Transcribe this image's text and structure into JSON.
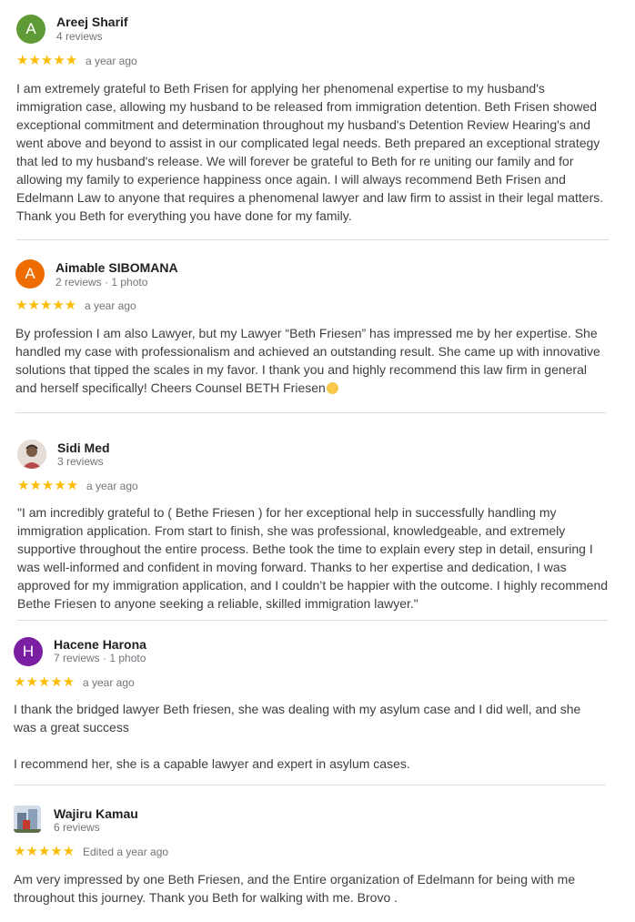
{
  "reviews": [
    {
      "initial": "A",
      "avatar_color": "#5e9b37",
      "name": "Areej Sharif",
      "meta": "4 reviews",
      "stars": "★★★★★",
      "ago": "a year ago",
      "text": "I am extremely grateful to Beth Frisen for applying her phenomenal expertise to my husband's immigration case, allowing my husband to be released from immigration detention. Beth Frisen showed exceptional commitment and determination throughout my husband's Detention Review Hearing's and went above and beyond to assist in our complicated legal needs. Beth prepared an exceptional strategy that led to my husband's release. We will forever be grateful to Beth for re uniting our family and for allowing my family to experience happiness once again. I will always recommend Beth Frisen and Edelmann Law to anyone that requires a phenomenal lawyer and law firm to assist in their legal matters. Thank you Beth for everything you have done for my family."
    },
    {
      "initial": "A",
      "avatar_color": "#ef6c00",
      "name": "Aimable SIBOMANA",
      "meta": "2 reviews · 1 photo",
      "stars": "★★★★★",
      "ago": "a year ago",
      "text": "By profession I am also Lawyer, but my Lawyer “Beth Friesen” has impressed me by her expertise. She handled my case with professionalism and achieved an outstanding result. She came up with innovative solutions that tipped the scales in my favor. I thank you and highly recommend this law firm in general and herself specifically! Cheers Counsel BETH Friesen"
    },
    {
      "initial": "",
      "avatar_color": "#c9b6a6",
      "name": "Sidi Med",
      "meta": "3 reviews",
      "stars": "★★★★★",
      "ago": "a year ago",
      "text": "\"I am incredibly grateful to ( Bethe Friesen ) for her exceptional help in successfully handling my immigration application. From start to finish, she was professional, knowledgeable, and extremely supportive throughout the entire process. Bethe took the time to explain every step in detail, ensuring I was well-informed and confident in moving forward. Thanks to her expertise and dedication, I was approved for my immigration application, and I couldn’t be happier with the outcome. I highly recommend Bethe Friesen to anyone seeking a reliable, skilled immigration lawyer.\""
    },
    {
      "initial": "H",
      "avatar_color": "#7b1fa2",
      "name": "Hacene Harona",
      "meta": "7 reviews · 1 photo",
      "stars": "★★★★★",
      "ago": "a year ago",
      "text": "I thank the bridged lawyer Beth friesen, she was dealing with my asylum case and I did well, and she was a great success",
      "text2": "I recommend her, she is a capable lawyer and expert in asylum cases."
    },
    {
      "initial": "",
      "avatar_color": "#8aa6c8",
      "name": "Wajiru Kamau",
      "meta": "6 reviews",
      "stars": "★★★★★",
      "ago": "Edited a year ago",
      "text": "Am very impressed by one Beth Friesen, and the Entire organization of Edelmann for being with me throughout this journey. Thank you Beth for walking with me. Brovo ."
    }
  ]
}
